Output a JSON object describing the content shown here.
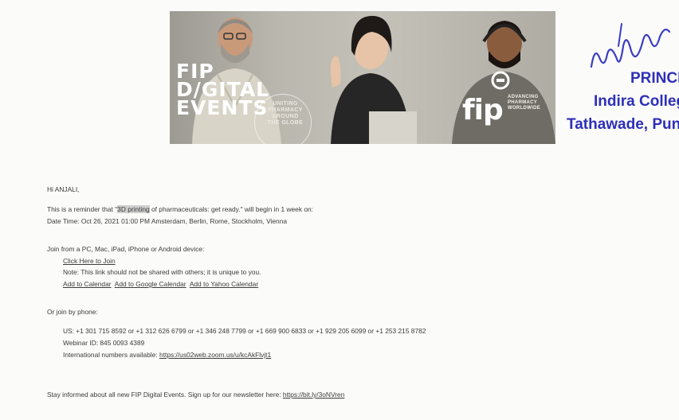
{
  "banner": {
    "title_lines": [
      "FIP",
      "D/GITAL",
      "EVENTS"
    ],
    "tagline_lines": [
      "UNITING",
      "PHARMACY",
      "AROUND",
      "THE GLOBE"
    ],
    "logo_text": "fip",
    "logo_sub_lines": [
      "ADVANCING",
      "PHARMACY",
      "WORLDWIDE"
    ]
  },
  "stamp": {
    "line1": "PRINCIPA",
    "line2": "Indira College of",
    "line3": "Tathawade, Pune"
  },
  "email": {
    "greeting": "Hi ANJALI,",
    "reminder_prefix": "This is a reminder that \"",
    "reminder_highlight": "3D printing",
    "reminder_suffix": " of pharmaceuticals: get ready.\" will begin in 1 week on:",
    "datetime": "Date Time: Oct 26, 2021 01:00 PM Amsterdam, Berlin, Rome, Stockholm, Vienna",
    "join_intro": "Join from a PC, Mac, iPad, iPhone or Android device:",
    "join_link": "Click Here to Join",
    "join_note": "Note: This link should not be shared with others; it is unique to you.",
    "calendar_links": [
      "Add to Calendar",
      "Add to Google Calendar",
      "Add to Yahoo Calendar"
    ],
    "phone_intro": "Or join by phone:",
    "phone_numbers": "US: +1 301 715 8592 or +1 312 626 6799 or +1 346 248 7799 or +1 669 900 6833 or +1 929 205 6099 or +1 253 215 8782",
    "webinar_id": "Webinar ID: 845 0093 4389",
    "intl_label": "International numbers available: ",
    "intl_link": "https://us02web.zoom.us/u/kcAkFlvjt1",
    "newsletter_text": "Stay informed about all new FIP Digital Events. Sign up for our newsletter here: ",
    "newsletter_link": "https://bit.ly/3oNVren"
  }
}
